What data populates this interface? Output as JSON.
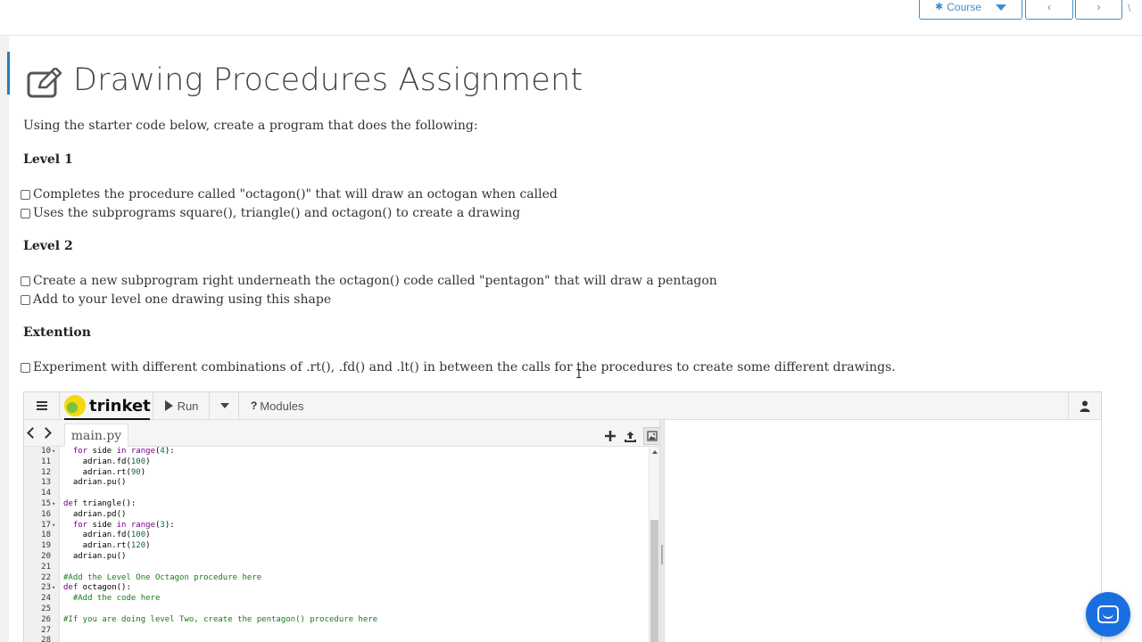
{
  "topbar": {
    "course_label": "Course",
    "prev_label": "‹",
    "next_label": "›",
    "edge_mark": "\\"
  },
  "page": {
    "title": "Drawing Procedures Assignment",
    "intro": "Using the starter code below, create a program that does the following:",
    "level1": {
      "heading": "Level 1",
      "items": [
        "Completes the procedure called \"octagon()\" that will draw an octogan when called",
        "Uses the subprograms square(), triangle() and octagon() to create a drawing"
      ]
    },
    "level2": {
      "heading": "Level 2",
      "items": [
        "Create a new subprogram right underneath the octagon() code called \"pentagon\" that will draw a pentagon",
        "Add to your level one drawing using this shape"
      ]
    },
    "extension": {
      "heading": "Extention",
      "items": [
        "Experiment with different combinations of .rt(), .fd() and .lt() in between the calls for the procedures to create some different drawings."
      ]
    }
  },
  "trinket": {
    "logo_text": "trinket",
    "run_label": "Run",
    "modules_label": "Modules",
    "modules_prefix": "?",
    "file_tab": "main.py",
    "code_lines": [
      {
        "n": "10",
        "fold": "▾",
        "text": "  for side in range(4):"
      },
      {
        "n": "11",
        "fold": "",
        "text": "    adrian.fd(100)"
      },
      {
        "n": "12",
        "fold": "",
        "text": "    adrian.rt(90)"
      },
      {
        "n": "13",
        "fold": "",
        "text": "  adrian.pu()"
      },
      {
        "n": "14",
        "fold": "",
        "text": ""
      },
      {
        "n": "15",
        "fold": "▾",
        "text": "def triangle():"
      },
      {
        "n": "16",
        "fold": "",
        "text": "  adrian.pd()"
      },
      {
        "n": "17",
        "fold": "▾",
        "text": "  for side in range(3):"
      },
      {
        "n": "18",
        "fold": "",
        "text": "    adrian.fd(100)"
      },
      {
        "n": "19",
        "fold": "",
        "text": "    adrian.rt(120)"
      },
      {
        "n": "20",
        "fold": "",
        "text": "  adrian.pu()"
      },
      {
        "n": "21",
        "fold": "",
        "text": ""
      },
      {
        "n": "22",
        "fold": "",
        "text": "#Add the Level One Octagon procedure here"
      },
      {
        "n": "23",
        "fold": "▾",
        "text": "def octagon():"
      },
      {
        "n": "24",
        "fold": "",
        "text": "  #Add the code here"
      },
      {
        "n": "25",
        "fold": "",
        "text": ""
      },
      {
        "n": "26",
        "fold": "",
        "text": "#If you are doing level Two, create the pentagon() procedure here"
      },
      {
        "n": "27",
        "fold": "",
        "text": ""
      },
      {
        "n": "28",
        "fold": "",
        "text": ""
      }
    ]
  },
  "colors": {
    "accent": "#3b8fd0",
    "comment": "#1a7a1a",
    "keyword": "#770088",
    "number": "#116644",
    "chat": "#1a6fe0"
  }
}
